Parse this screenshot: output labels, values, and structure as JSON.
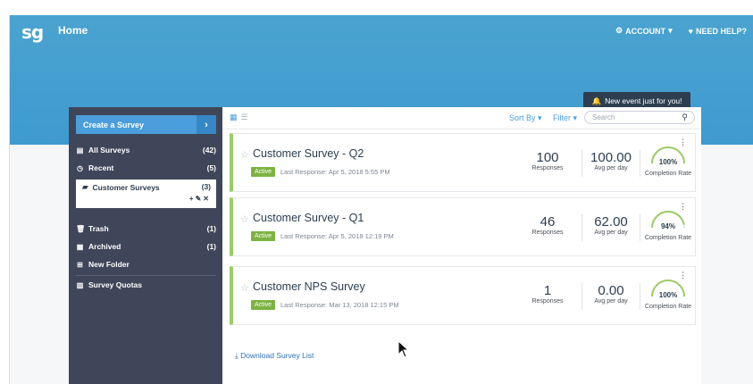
{
  "header": {
    "logo": "sg",
    "title": "Home",
    "account_label": "ACCOUNT",
    "help_label": "NEED HELP?"
  },
  "event_tip": "New event just for you!",
  "sidebar": {
    "create_label": "Create a Survey",
    "items": [
      {
        "label": "All Surveys",
        "count": "(42)",
        "icon": "file-icon"
      },
      {
        "label": "Recent",
        "count": "(5)",
        "icon": "clock-icon"
      },
      {
        "label": "Customer Surveys",
        "count": "(3)",
        "icon": "folder-open-icon"
      },
      {
        "label": "Trash",
        "count": "(1)",
        "icon": "trash-icon"
      },
      {
        "label": "Archived",
        "count": "(1)",
        "icon": "archive-icon"
      },
      {
        "label": "New Folder",
        "count": "",
        "icon": "plus-square-icon"
      },
      {
        "label": "Survey Quotas",
        "count": "",
        "icon": "bar-chart-icon"
      }
    ]
  },
  "toolbar": {
    "sort_label": "Sort By",
    "filter_label": "Filter",
    "search_placeholder": "Search"
  },
  "surveys": [
    {
      "title": "Customer Survey - Q2",
      "status": "Active",
      "last_response": "Last Response: Apr 5, 2018 5:55 PM",
      "responses": "100",
      "responses_label": "Responses",
      "avg_per_day": "100.00",
      "avg_label": "Avg per day",
      "completion": "100%",
      "completion_value": 100,
      "completion_label": "Completion Rate"
    },
    {
      "title": "Customer Survey - Q1",
      "status": "Active",
      "last_response": "Last Response: Apr 5, 2018 12:19 PM",
      "responses": "46",
      "responses_label": "Responses",
      "avg_per_day": "62.00",
      "avg_label": "Avg per day",
      "completion": "94%",
      "completion_value": 94,
      "completion_label": "Completion Rate"
    },
    {
      "title": "Customer NPS Survey",
      "status": "Active",
      "last_response": "Last Response: Mar 13, 2018 12:15 PM",
      "responses": "1",
      "responses_label": "Responses",
      "avg_per_day": "0.00",
      "avg_label": "Avg per day",
      "completion": "100%",
      "completion_value": 100,
      "completion_label": "Completion Rate"
    }
  ],
  "download_label": "Download Survey List",
  "colors": {
    "banner": "#4aa3cf",
    "sidebar": "#404659",
    "accent": "#4a9edb",
    "active_badge": "#7cb342",
    "gauge": "#9ccc65"
  }
}
